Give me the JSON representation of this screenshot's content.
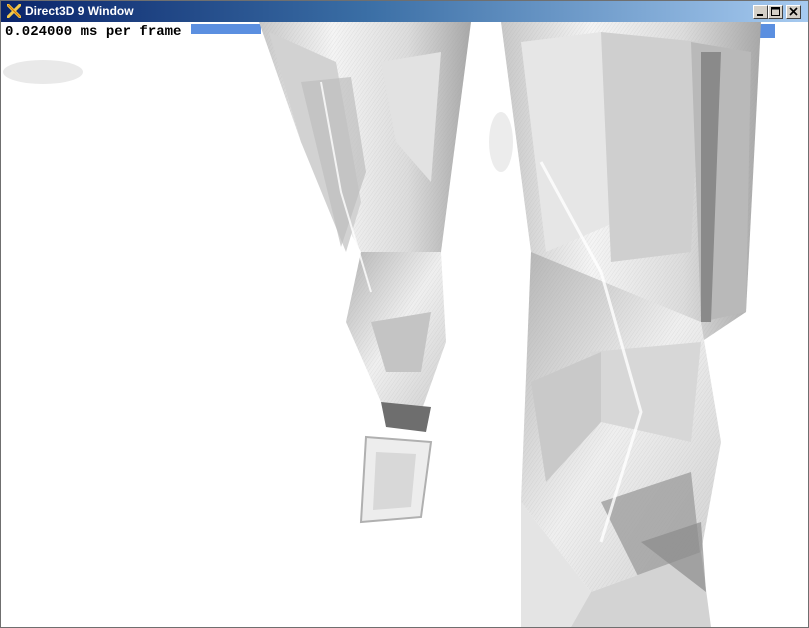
{
  "window": {
    "title": "Direct3D 9 Window"
  },
  "titlebar_buttons": {
    "minimize": "minimize-icon",
    "maximize": "maximize-icon",
    "close": "close-icon"
  },
  "overlay": {
    "frame_time_text": "0.024000 ms per frame"
  },
  "colors": {
    "titlebar_start": "#0a246a",
    "titlebar_end": "#a6caf0",
    "sky_blue": "#5b8fe0",
    "overlay_text": "#000000"
  }
}
